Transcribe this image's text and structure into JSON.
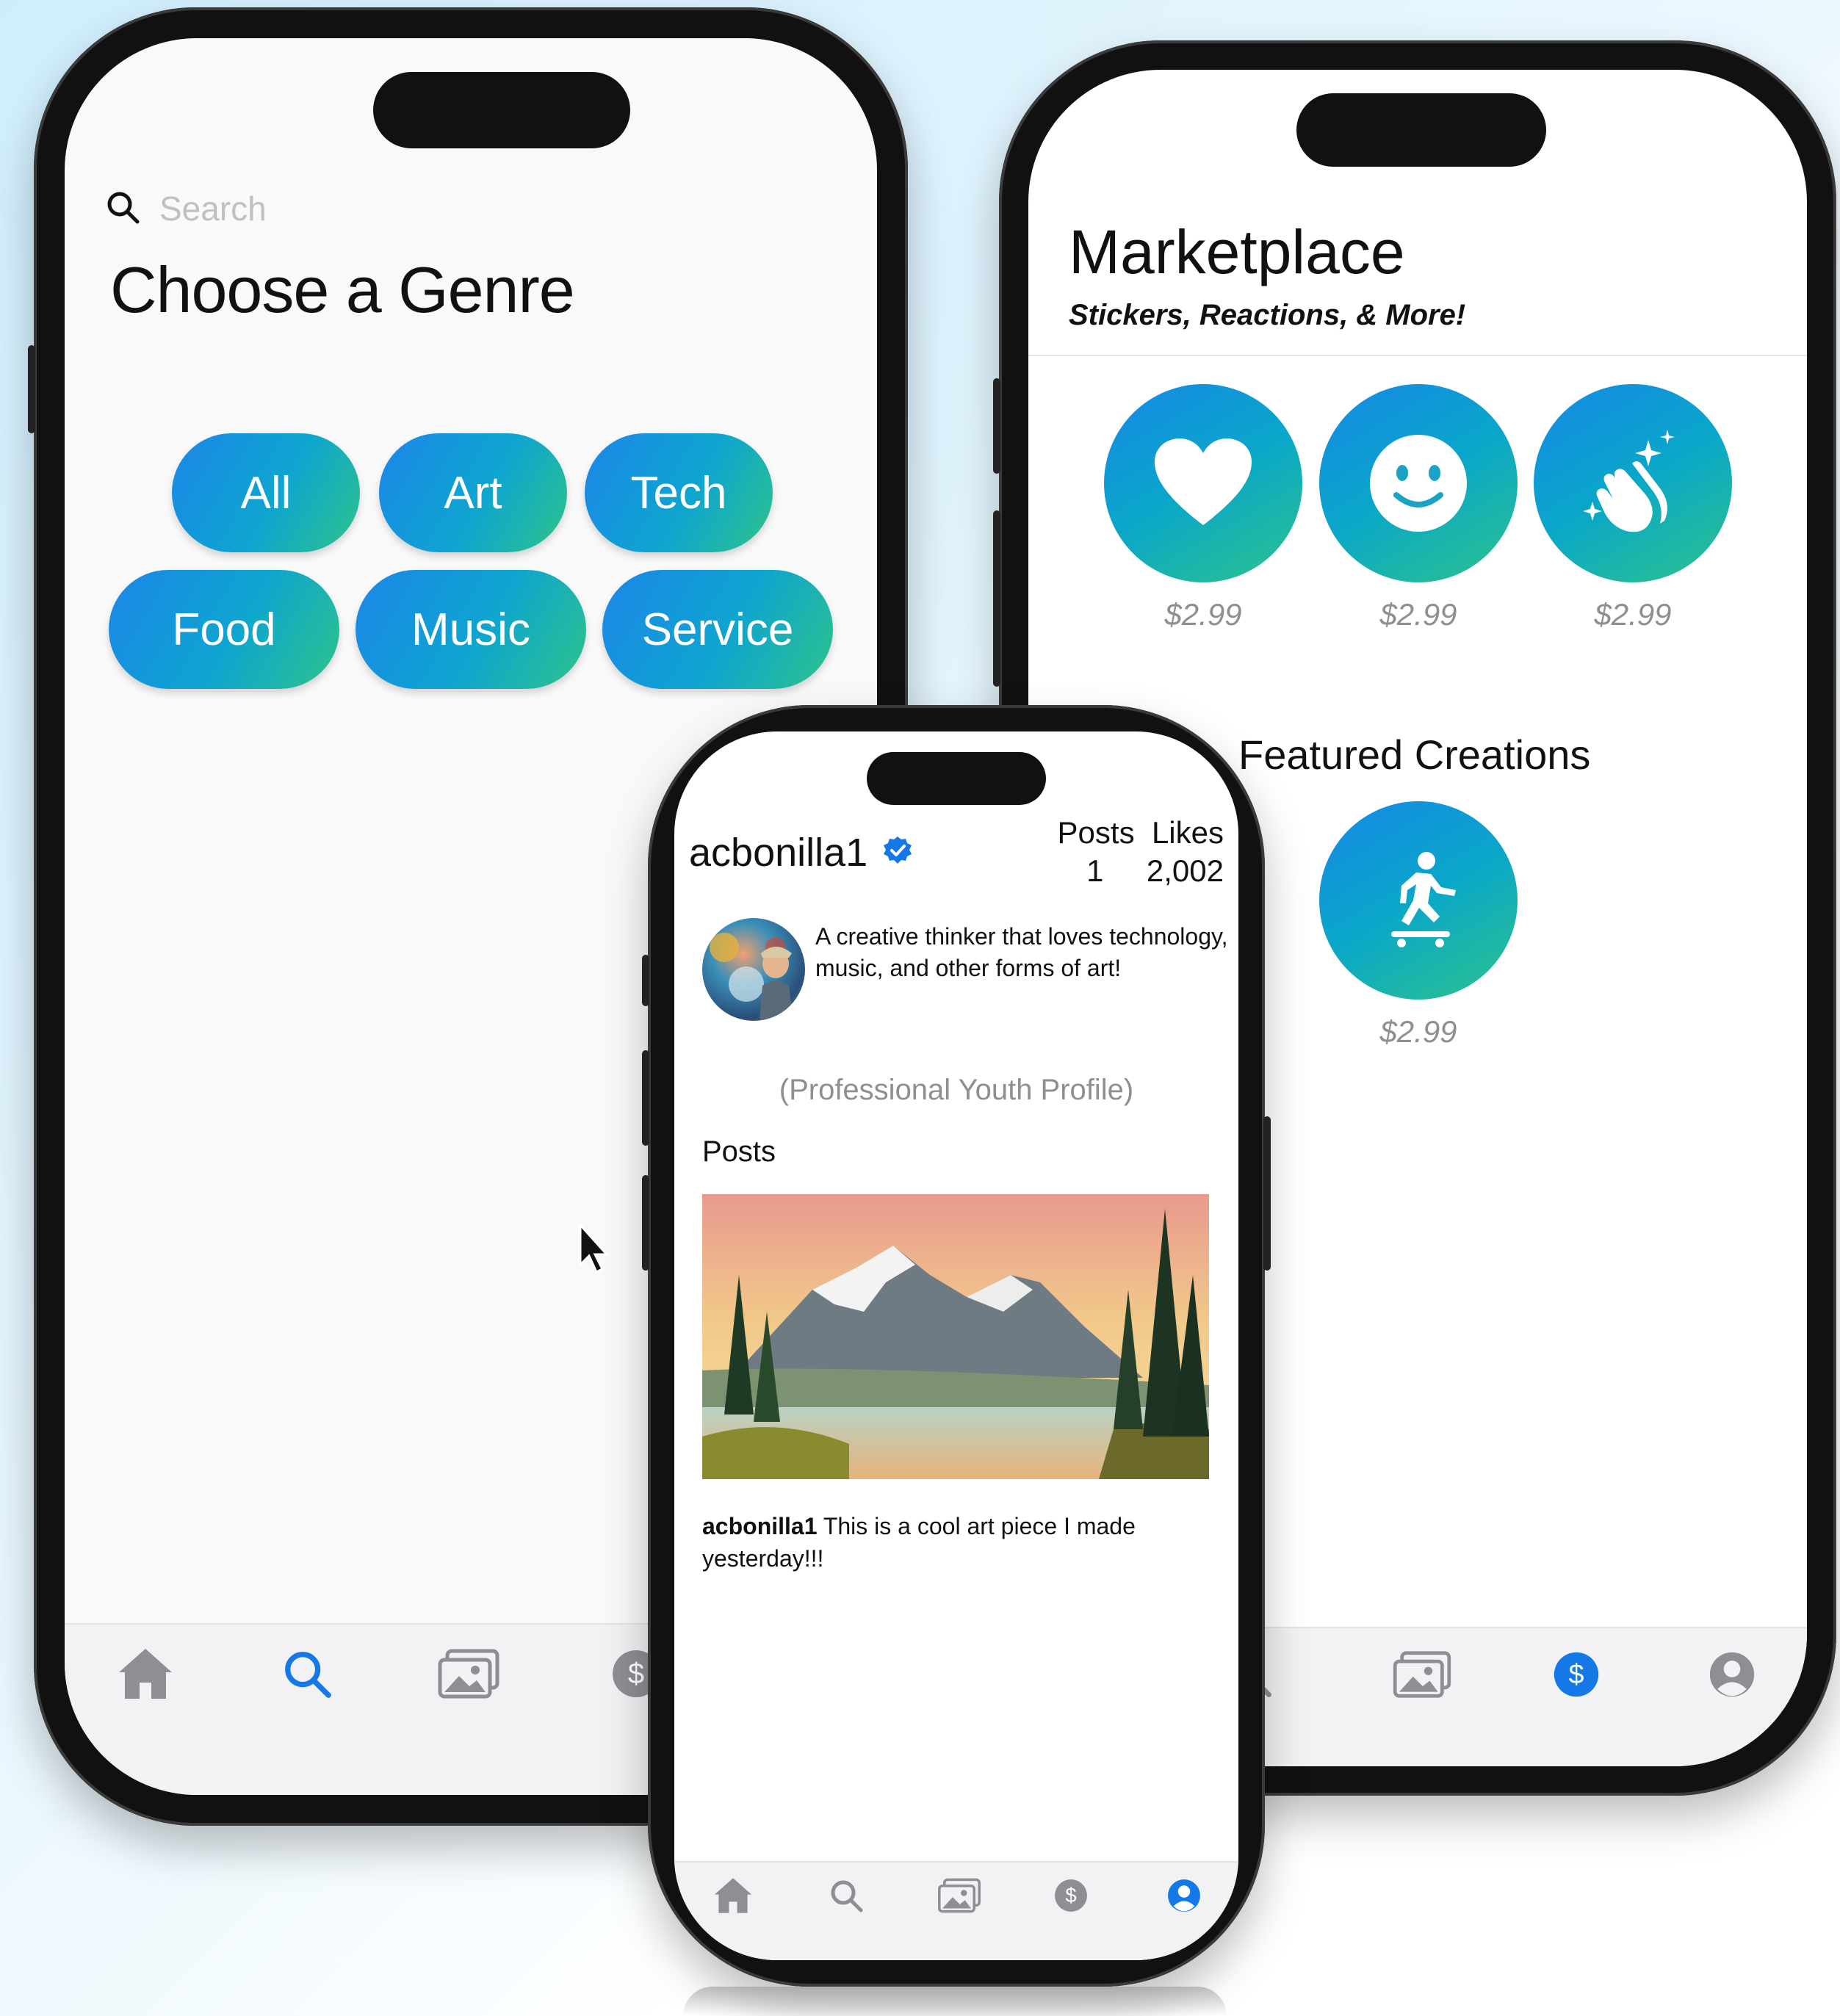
{
  "genre_screen": {
    "search_placeholder": "Search",
    "title": "Choose a Genre",
    "genres": [
      "All",
      "Art",
      "Tech",
      "Food",
      "Music",
      "Service"
    ],
    "tabs": [
      "home-icon",
      "search-icon",
      "gallery-icon",
      "dollar-icon"
    ],
    "active_tab": "search-icon"
  },
  "marketplace_screen": {
    "title": "Marketplace",
    "subtitle": "Stickers, Reactions, & More!",
    "items": [
      {
        "icon": "heart-icon",
        "price": "$2.99"
      },
      {
        "icon": "smiley-icon",
        "price": "$2.99"
      },
      {
        "icon": "clapping-hands-icon",
        "price": "$2.99"
      }
    ],
    "featured_title": "Featured Creations",
    "featured": [
      {
        "icon": "skateboarder-icon",
        "price": "$2.99"
      }
    ],
    "tabs": [
      "search-icon",
      "gallery-icon",
      "dollar-icon",
      "profile-icon"
    ],
    "active_tab": "dollar-icon"
  },
  "profile_screen": {
    "username": "acbonilla1",
    "verified": true,
    "stats": {
      "posts_label": "Posts",
      "likes_label": "Likes",
      "posts_value": "1",
      "likes_value": "2,002"
    },
    "bio": "A creative thinker that loves technology, music, and other forms of art!",
    "profile_type": "(Professional Youth Profile)",
    "posts_heading": "Posts",
    "post": {
      "author": "acbonilla1",
      "caption": "This is a cool art piece I made yesterday!!!"
    },
    "tabs": [
      "home-icon",
      "search-icon",
      "gallery-icon",
      "dollar-icon",
      "profile-icon"
    ],
    "active_tab": "profile-icon"
  },
  "colors": {
    "accent_blue": "#1478e6",
    "gradient_start": "#1688e6",
    "gradient_end": "#2dc38a",
    "inactive_icon": "#8e8e93"
  }
}
